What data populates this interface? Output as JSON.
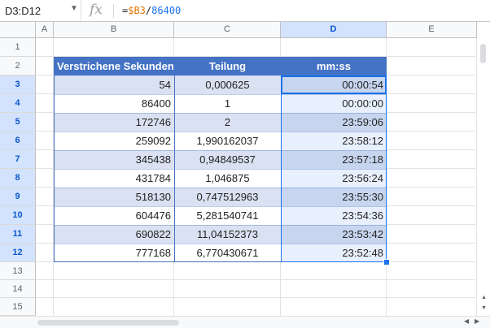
{
  "formula_bar": {
    "name_box": "D3:D12",
    "fx_label": "fx",
    "formula_prefix": "=",
    "formula_ref": "$B3",
    "formula_op": "/",
    "formula_num": "86400"
  },
  "columns": [
    "A",
    "B",
    "C",
    "D",
    "E"
  ],
  "rows": [
    "1",
    "2",
    "3",
    "4",
    "5",
    "6",
    "7",
    "8",
    "9",
    "10",
    "11",
    "12",
    "13",
    "14",
    "15"
  ],
  "table": {
    "headers": [
      "Verstrichene Sekunden",
      "Teilung",
      "mm:ss"
    ],
    "rows": [
      [
        "54",
        "0,000625",
        "00:00:54"
      ],
      [
        "86400",
        "1",
        "00:00:00"
      ],
      [
        "172746",
        "2",
        "23:59:06"
      ],
      [
        "259092",
        "1,990162037",
        "23:58:12"
      ],
      [
        "345438",
        "0,94849537",
        "23:57:18"
      ],
      [
        "431784",
        "1,046875",
        "23:56:24"
      ],
      [
        "518130",
        "0,747512963",
        "23:55:30"
      ],
      [
        "604476",
        "5,281540741",
        "23:54:36"
      ],
      [
        "690822",
        "11,04152373",
        "23:53:42"
      ],
      [
        "777168",
        "6,770430671",
        "23:52:48"
      ]
    ]
  },
  "colors": {
    "header_bg": "#4472c4",
    "band_bg": "#d9e1f2",
    "selection": "#1a73e8"
  }
}
